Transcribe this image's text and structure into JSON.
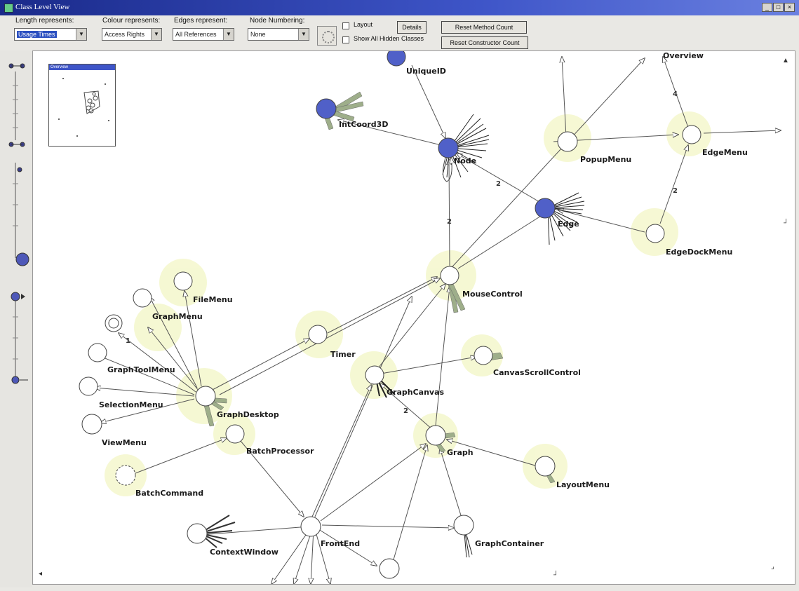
{
  "window": {
    "title": "Class Level View",
    "controls": [
      "_",
      "□",
      "×"
    ]
  },
  "toolbar": {
    "length_label": "Length represents:",
    "length_value": "Usage Times",
    "colour_label": "Colour represents:",
    "colour_value": "Access Rights",
    "edges_label": "Edges represent:",
    "edges_value": "All References",
    "numbering_label": "Node Numbering:",
    "numbering_value": "None",
    "layout_label": "Layout",
    "show_hidden_label": "Show All Hidden Classes",
    "details_button": "Details",
    "reset_method_button": "Reset Method Count",
    "reset_constructor_button": "Reset Constructor Count"
  },
  "minimap": {
    "title": "Overview"
  },
  "graph": {
    "nodes": [
      {
        "id": "uniqueid",
        "label": "UniqueID",
        "filled": true
      },
      {
        "id": "intcoord",
        "label": "IntCoord3D",
        "filled": true
      },
      {
        "id": "node",
        "label": "Node",
        "filled": true
      },
      {
        "id": "edge",
        "label": "Edge",
        "filled": true
      },
      {
        "id": "popupmenu",
        "label": "PopupMenu",
        "filled": false
      },
      {
        "id": "edgemenu",
        "label": "EdgeMenu",
        "filled": false
      },
      {
        "id": "edgedockmenu",
        "label": "EdgeDockMenu",
        "filled": false
      },
      {
        "id": "mousecontrol",
        "label": "MouseControl",
        "filled": false
      },
      {
        "id": "filemenu",
        "label": "FileMenu",
        "filled": false
      },
      {
        "id": "graphmenu",
        "label": "GraphMenu",
        "filled": false
      },
      {
        "id": "timer",
        "label": "Timer",
        "filled": false
      },
      {
        "id": "canvasscroll",
        "label": "CanvasScrollControl",
        "filled": false
      },
      {
        "id": "graphtoolmenu",
        "label": "GraphToolMenu",
        "filled": false
      },
      {
        "id": "graphcanvas",
        "label": "GraphCanvas",
        "filled": false
      },
      {
        "id": "selectionmenu",
        "label": "SelectionMenu",
        "filled": false
      },
      {
        "id": "graphdesktop",
        "label": "GraphDesktop",
        "filled": false
      },
      {
        "id": "viewmenu",
        "label": "ViewMenu",
        "filled": false
      },
      {
        "id": "batchprocessor",
        "label": "BatchProcessor",
        "filled": false
      },
      {
        "id": "graph",
        "label": "Graph",
        "filled": false
      },
      {
        "id": "layoutmenu",
        "label": "LayoutMenu",
        "filled": false
      },
      {
        "id": "batchcommand",
        "label": "BatchCommand",
        "filled": false
      },
      {
        "id": "contextwindow",
        "label": "ContextWindow",
        "filled": false
      },
      {
        "id": "frontend",
        "label": "FrontEnd",
        "filled": false
      },
      {
        "id": "graphcontainer",
        "label": "GraphContainer",
        "filled": false
      }
    ],
    "edge_counts": [
      "2",
      "2",
      "4",
      "2",
      "2",
      "1"
    ],
    "top_right_partial_label": "Overview"
  },
  "colors": {
    "accessed_node": "#5060c8",
    "node_halo": "#f4f7cc",
    "edge": "#555555"
  }
}
